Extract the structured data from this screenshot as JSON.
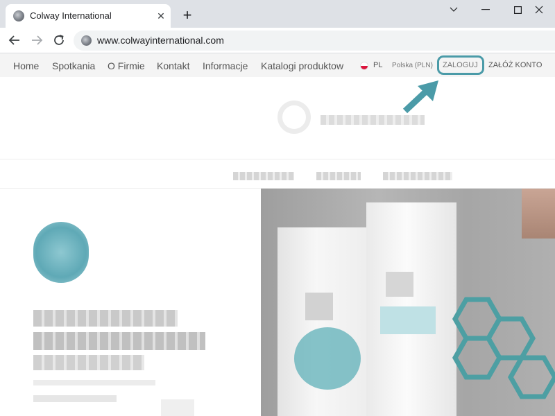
{
  "browser": {
    "tab": {
      "title": "Colway International",
      "close_glyph": "✕",
      "favicon": "globe-icon"
    },
    "new_tab_glyph": "+",
    "url": "www.colwayinternational.com",
    "controls": [
      "minimize-icon",
      "maximize-icon",
      "close-icon"
    ]
  },
  "site_nav": {
    "items": [
      {
        "label": "Home"
      },
      {
        "label": "Spotkania"
      },
      {
        "label": "O Firmie"
      },
      {
        "label": "Kontakt"
      },
      {
        "label": "Informacje"
      },
      {
        "label": "Katalogi produktow"
      }
    ],
    "language": "PL",
    "currency": "Polska (PLN)",
    "login": "ZALOGUJ",
    "register": "ZAŁÓŻ KONTO"
  },
  "colors": {
    "accent_teal": "#4b9ba8",
    "nav_bg": "#f4f4f4",
    "tabbar_bg": "#dee1e6",
    "flag_red": "#dc143c"
  }
}
